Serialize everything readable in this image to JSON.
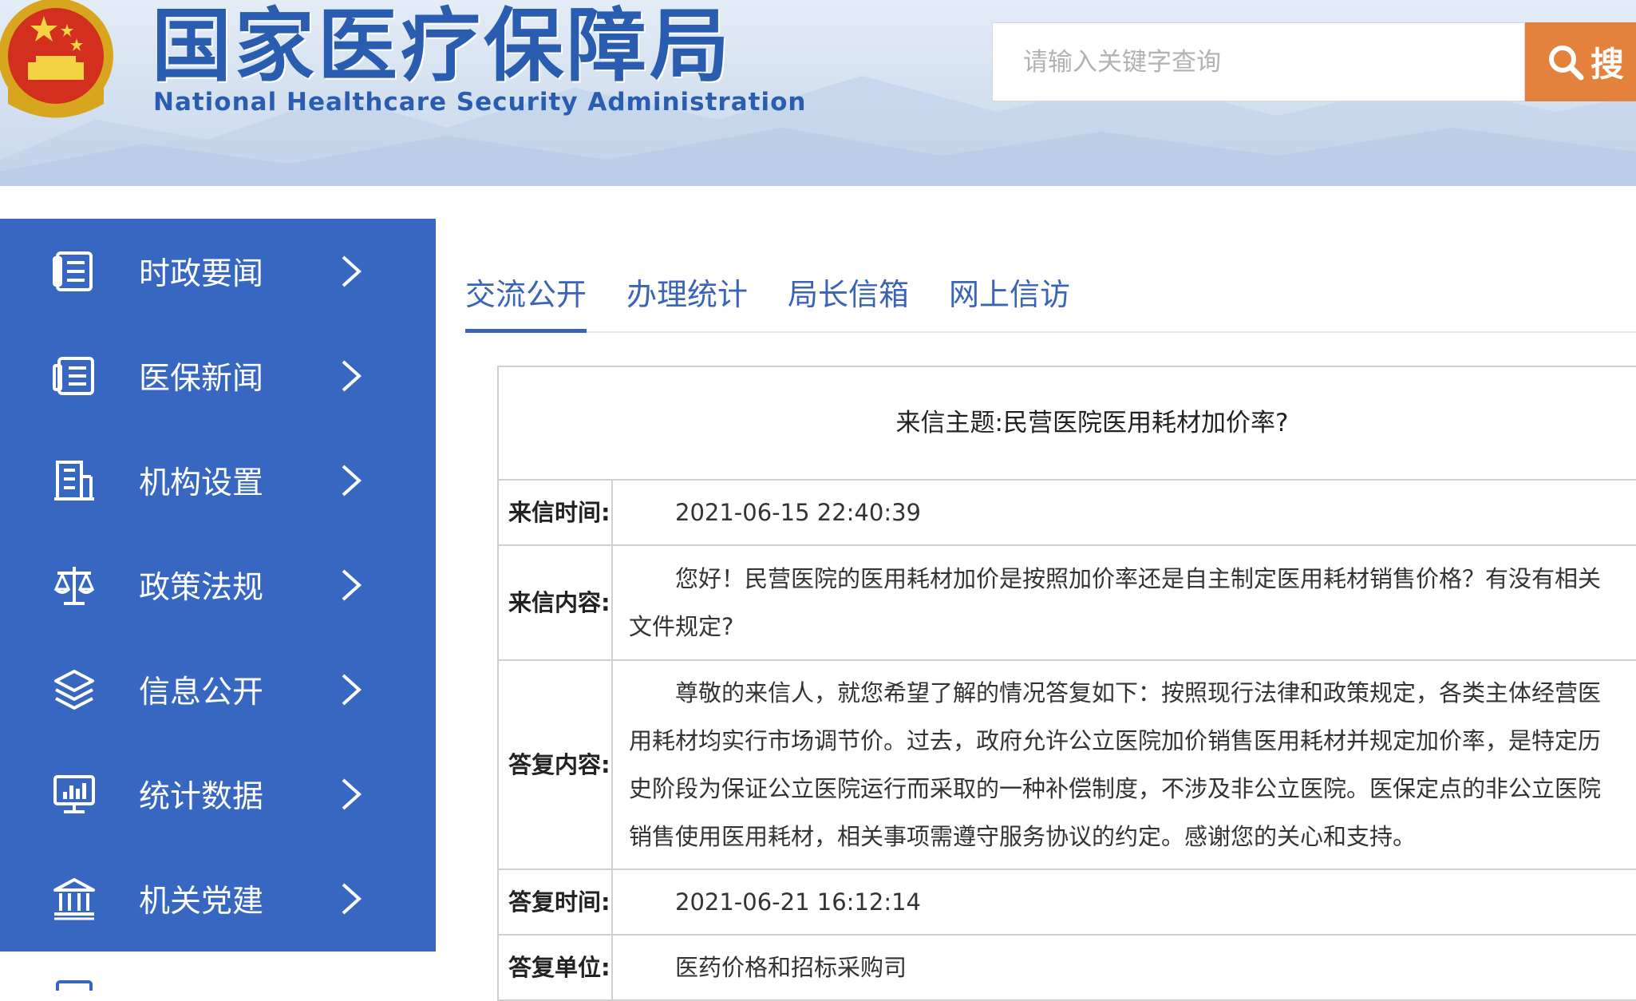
{
  "header": {
    "title": "国家医疗保障局",
    "subtitle": "National Healthcare Security Administration",
    "search": {
      "placeholder": "请输入关键字查询",
      "button_label": "搜"
    }
  },
  "sidebar": {
    "items": [
      {
        "label": "时政要闻",
        "icon": "document-list-icon"
      },
      {
        "label": "医保新闻",
        "icon": "news-icon"
      },
      {
        "label": "机构设置",
        "icon": "building-icon"
      },
      {
        "label": "政策法规",
        "icon": "scales-icon"
      },
      {
        "label": "信息公开",
        "icon": "layers-icon"
      },
      {
        "label": "统计数据",
        "icon": "monitor-chart-icon"
      },
      {
        "label": "机关党建",
        "icon": "institution-icon"
      }
    ]
  },
  "tabs": [
    {
      "label": "交流公开",
      "active": true
    },
    {
      "label": "办理统计",
      "active": false
    },
    {
      "label": "局长信箱",
      "active": false
    },
    {
      "label": "网上信访",
      "active": false
    }
  ],
  "letter": {
    "subject": "来信主题:民营医院医用耗材加价率?",
    "rows": [
      {
        "label": "来信时间:",
        "value": "2021-06-15 22:40:39"
      },
      {
        "label": "来信内容:",
        "value": "您好！民营医院的医用耗材加价是按照加价率还是自主制定医用耗材销售价格？有没有相关文件规定?"
      },
      {
        "label": "答复内容:",
        "value": "尊敬的来信人，就您希望了解的情况答复如下：按照现行法律和政策规定，各类主体经营医用耗材均实行市场调节价。过去，政府允许公立医院加价销售医用耗材并规定加价率，是特定历史阶段为保证公立医院运行而采取的一种补偿制度，不涉及非公立医院。医保定点的非公立医院销售使用医用耗材，相关事项需遵守服务协议的约定。感谢您的关心和支持。"
      },
      {
        "label": "答复时间:",
        "value": "2021-06-21 16:12:14"
      },
      {
        "label": "答复单位:",
        "value": "医药价格和招标采购司"
      }
    ]
  },
  "colors": {
    "sidebar": "#3767c0",
    "accent": "#3a64b5",
    "search_button": "#e4813d",
    "border": "#cfcfcf"
  }
}
